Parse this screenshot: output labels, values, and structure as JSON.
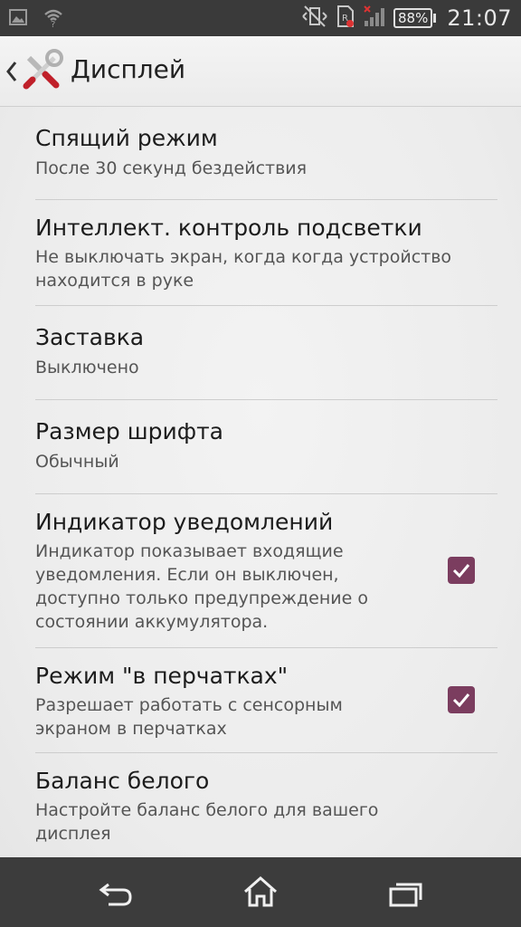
{
  "status_bar": {
    "battery": "88%",
    "time": "21:07",
    "icons": [
      "image-icon",
      "wifi-icon",
      "vibrate-off-icon",
      "sim-icon",
      "signal-icon",
      "battery-icon"
    ]
  },
  "action_bar": {
    "title": "Дисплей",
    "icon": "tools-icon"
  },
  "settings": [
    {
      "title": "Спящий режим",
      "subtitle": "После 30 секунд бездействия"
    },
    {
      "title": "Интеллект. контроль подсветки",
      "subtitle": "Не выключать экран, когда когда устройство находится в руке"
    },
    {
      "title": "Заставка",
      "subtitle": "Выключено"
    },
    {
      "title": "Размер шрифта",
      "subtitle": "Обычный"
    },
    {
      "title": "Индикатор уведомлений",
      "subtitle": "Индикатор показывает входящие уведомления. Если он выключен, доступно только предупреждение о состоянии аккумулятора.",
      "checked": true
    },
    {
      "title": "Режим \"в перчатках\"",
      "subtitle": "Разрешает работать с сенсорным экраном в перчатках",
      "checked": true
    },
    {
      "title": "Баланс белого",
      "subtitle": "Настройте баланс белого для вашего дисплея"
    }
  ],
  "nav_bar": {
    "buttons": [
      "back-icon",
      "home-icon",
      "recent-apps-icon"
    ]
  },
  "colors": {
    "checkbox": "#7b3d5f",
    "status_bar": "#3a3a3a",
    "nav_bar": "#3c3c3c"
  }
}
